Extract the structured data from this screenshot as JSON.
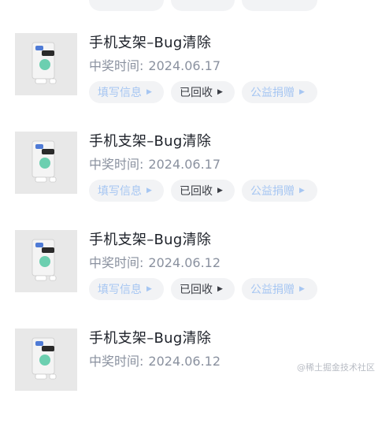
{
  "labels": {
    "fill_info": "填写信息",
    "recycled": "已回收",
    "donate": "公益捐赠",
    "win_time_label": "中奖时间:"
  },
  "prizes": [
    {
      "title": "手机支架–Bug清除",
      "date": "2024.06.17"
    },
    {
      "title": "手机支架–Bug清除",
      "date": "2024.06.17"
    },
    {
      "title": "手机支架–Bug清除",
      "date": "2024.06.12"
    },
    {
      "title": "手机支架–Bug清除",
      "date": "2024.06.12"
    }
  ],
  "watermark": "@稀土掘金技术社区",
  "icons": {
    "caret": "caret-right-icon",
    "thumbnail": "phone-holder-image"
  },
  "colors": {
    "link": "#a6c6f2",
    "pill_bg": "#f2f3f5",
    "title": "#1d2129",
    "meta": "#8a919f"
  }
}
